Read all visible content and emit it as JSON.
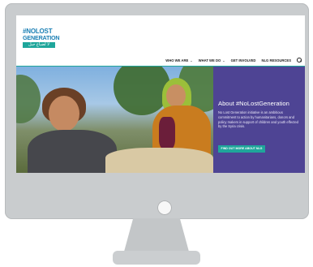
{
  "logo": {
    "hash_line": "#NOLOST",
    "line2": "GENERATION",
    "arabic": "لا لضياع جيل"
  },
  "nav": {
    "items": [
      {
        "label": "WHO WE ARE",
        "has_dropdown": true
      },
      {
        "label": "WHAT WE DO",
        "has_dropdown": true
      },
      {
        "label": "GET INVOLVED",
        "has_dropdown": false
      },
      {
        "label": "NLG RESOURCES",
        "has_dropdown": false
      }
    ],
    "search_icon": "search-icon"
  },
  "hero": {
    "title": "About #NoLostGeneration",
    "text": "No Lost Generation initiative is an ambitious commitment to action by humanitarians, donors and policy makers in support of children and youth effected by the Syria crisis.",
    "button_label": "FIND OUT MORE ABOUT NLG"
  },
  "colors": {
    "panel": "#4e4494",
    "accent": "#1fa69b",
    "monitor": "#c9ccce"
  }
}
